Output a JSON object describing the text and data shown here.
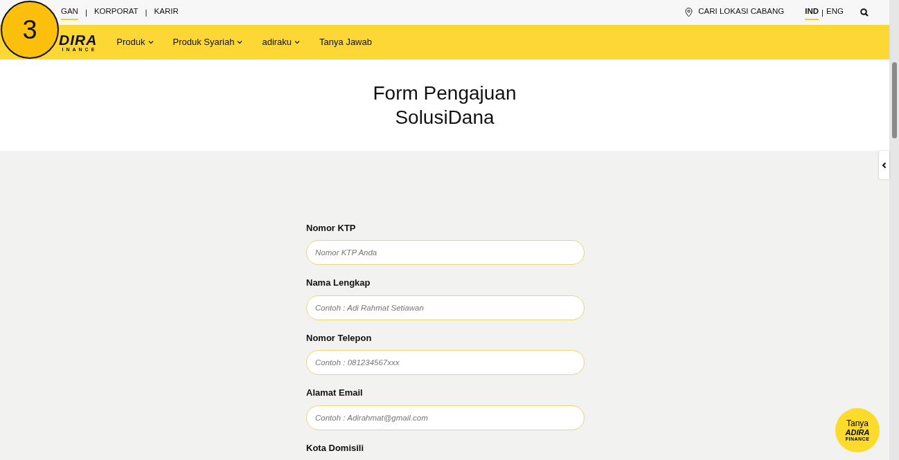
{
  "step_badge": "3",
  "separator": "|",
  "top_links": [
    {
      "label": "GAN",
      "selected": true
    },
    {
      "label": "KORPORAT",
      "selected": false
    },
    {
      "label": "KARIR",
      "selected": false
    }
  ],
  "branch_link": "CARI LOKASI CABANG",
  "languages": [
    {
      "label": "IND",
      "selected": true
    },
    {
      "label": "ENG",
      "selected": false
    }
  ],
  "logo": {
    "word": "DIRA",
    "sub": "INANCE"
  },
  "nav": [
    {
      "label": "Produk",
      "dropdown": true
    },
    {
      "label": "Produk Syariah",
      "dropdown": true
    },
    {
      "label": "adiraku",
      "dropdown": true
    },
    {
      "label": "Tanya Jawab",
      "dropdown": false
    }
  ],
  "title": [
    "Form Pengajuan",
    "SolusiDana"
  ],
  "fields": [
    {
      "label": "Nomor KTP",
      "placeholder": "Nomor KTP Anda"
    },
    {
      "label": "Nama Lengkap",
      "placeholder": "Contoh : Adi Rahmat Setiawan"
    },
    {
      "label": "Nomor Telepon",
      "placeholder": "Contoh : 081234567xxx"
    },
    {
      "label": "Alamat Email",
      "placeholder": "Contoh : Adirahmat@gmail.com"
    },
    {
      "label": "Kota Domisili"
    }
  ],
  "chat_button": {
    "label": "Tanya",
    "logo": "ADIRA",
    "sub": "FINANCE"
  }
}
